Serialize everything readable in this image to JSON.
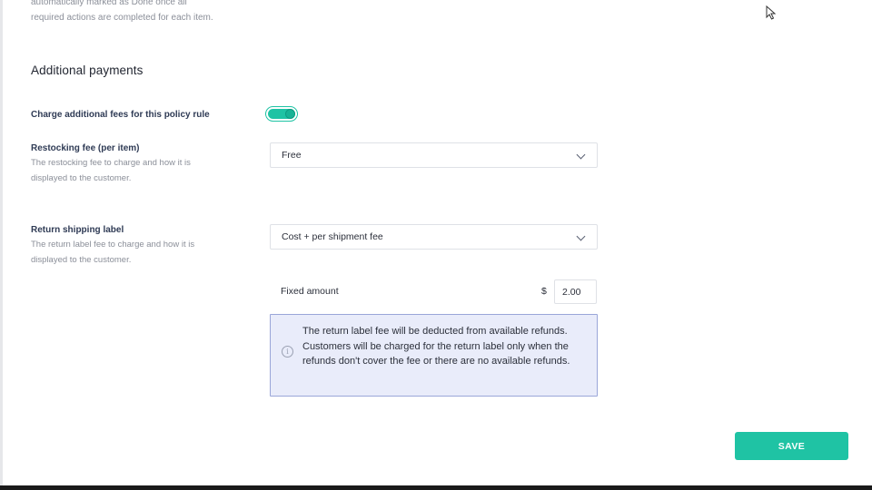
{
  "previous_section": {
    "description_tail": "automatically marked as Done once all required actions are completed for each item."
  },
  "additional_payments": {
    "title": "Additional payments",
    "charge_fees": {
      "label": "Charge additional fees for this policy rule",
      "enabled": true
    },
    "restocking_fee": {
      "label": "Restocking fee (per item)",
      "help": "The restocking fee to charge and how it is displayed to the customer.",
      "selected": "Free"
    },
    "return_shipping_label": {
      "label": "Return shipping label",
      "help": "The return label fee to charge and how it is displayed to the customer.",
      "selected": "Cost + per shipment fee"
    },
    "fixed_amount": {
      "label": "Fixed amount",
      "currency": "$",
      "value": "2.00"
    },
    "info_message": "The return label fee will be deducted from available refunds. Customers will be charged for the return label only when the refunds don't cover the fee or there are no available refunds."
  },
  "actions": {
    "save_label": "SAVE"
  },
  "colors": {
    "accent": "#1fc3a4",
    "info_bg": "#e9ecfa",
    "info_border": "#9aa6d9"
  },
  "icons": {
    "info": "info-icon",
    "chevron": "chevron-down-icon",
    "cursor": "mouse-pointer-icon"
  }
}
